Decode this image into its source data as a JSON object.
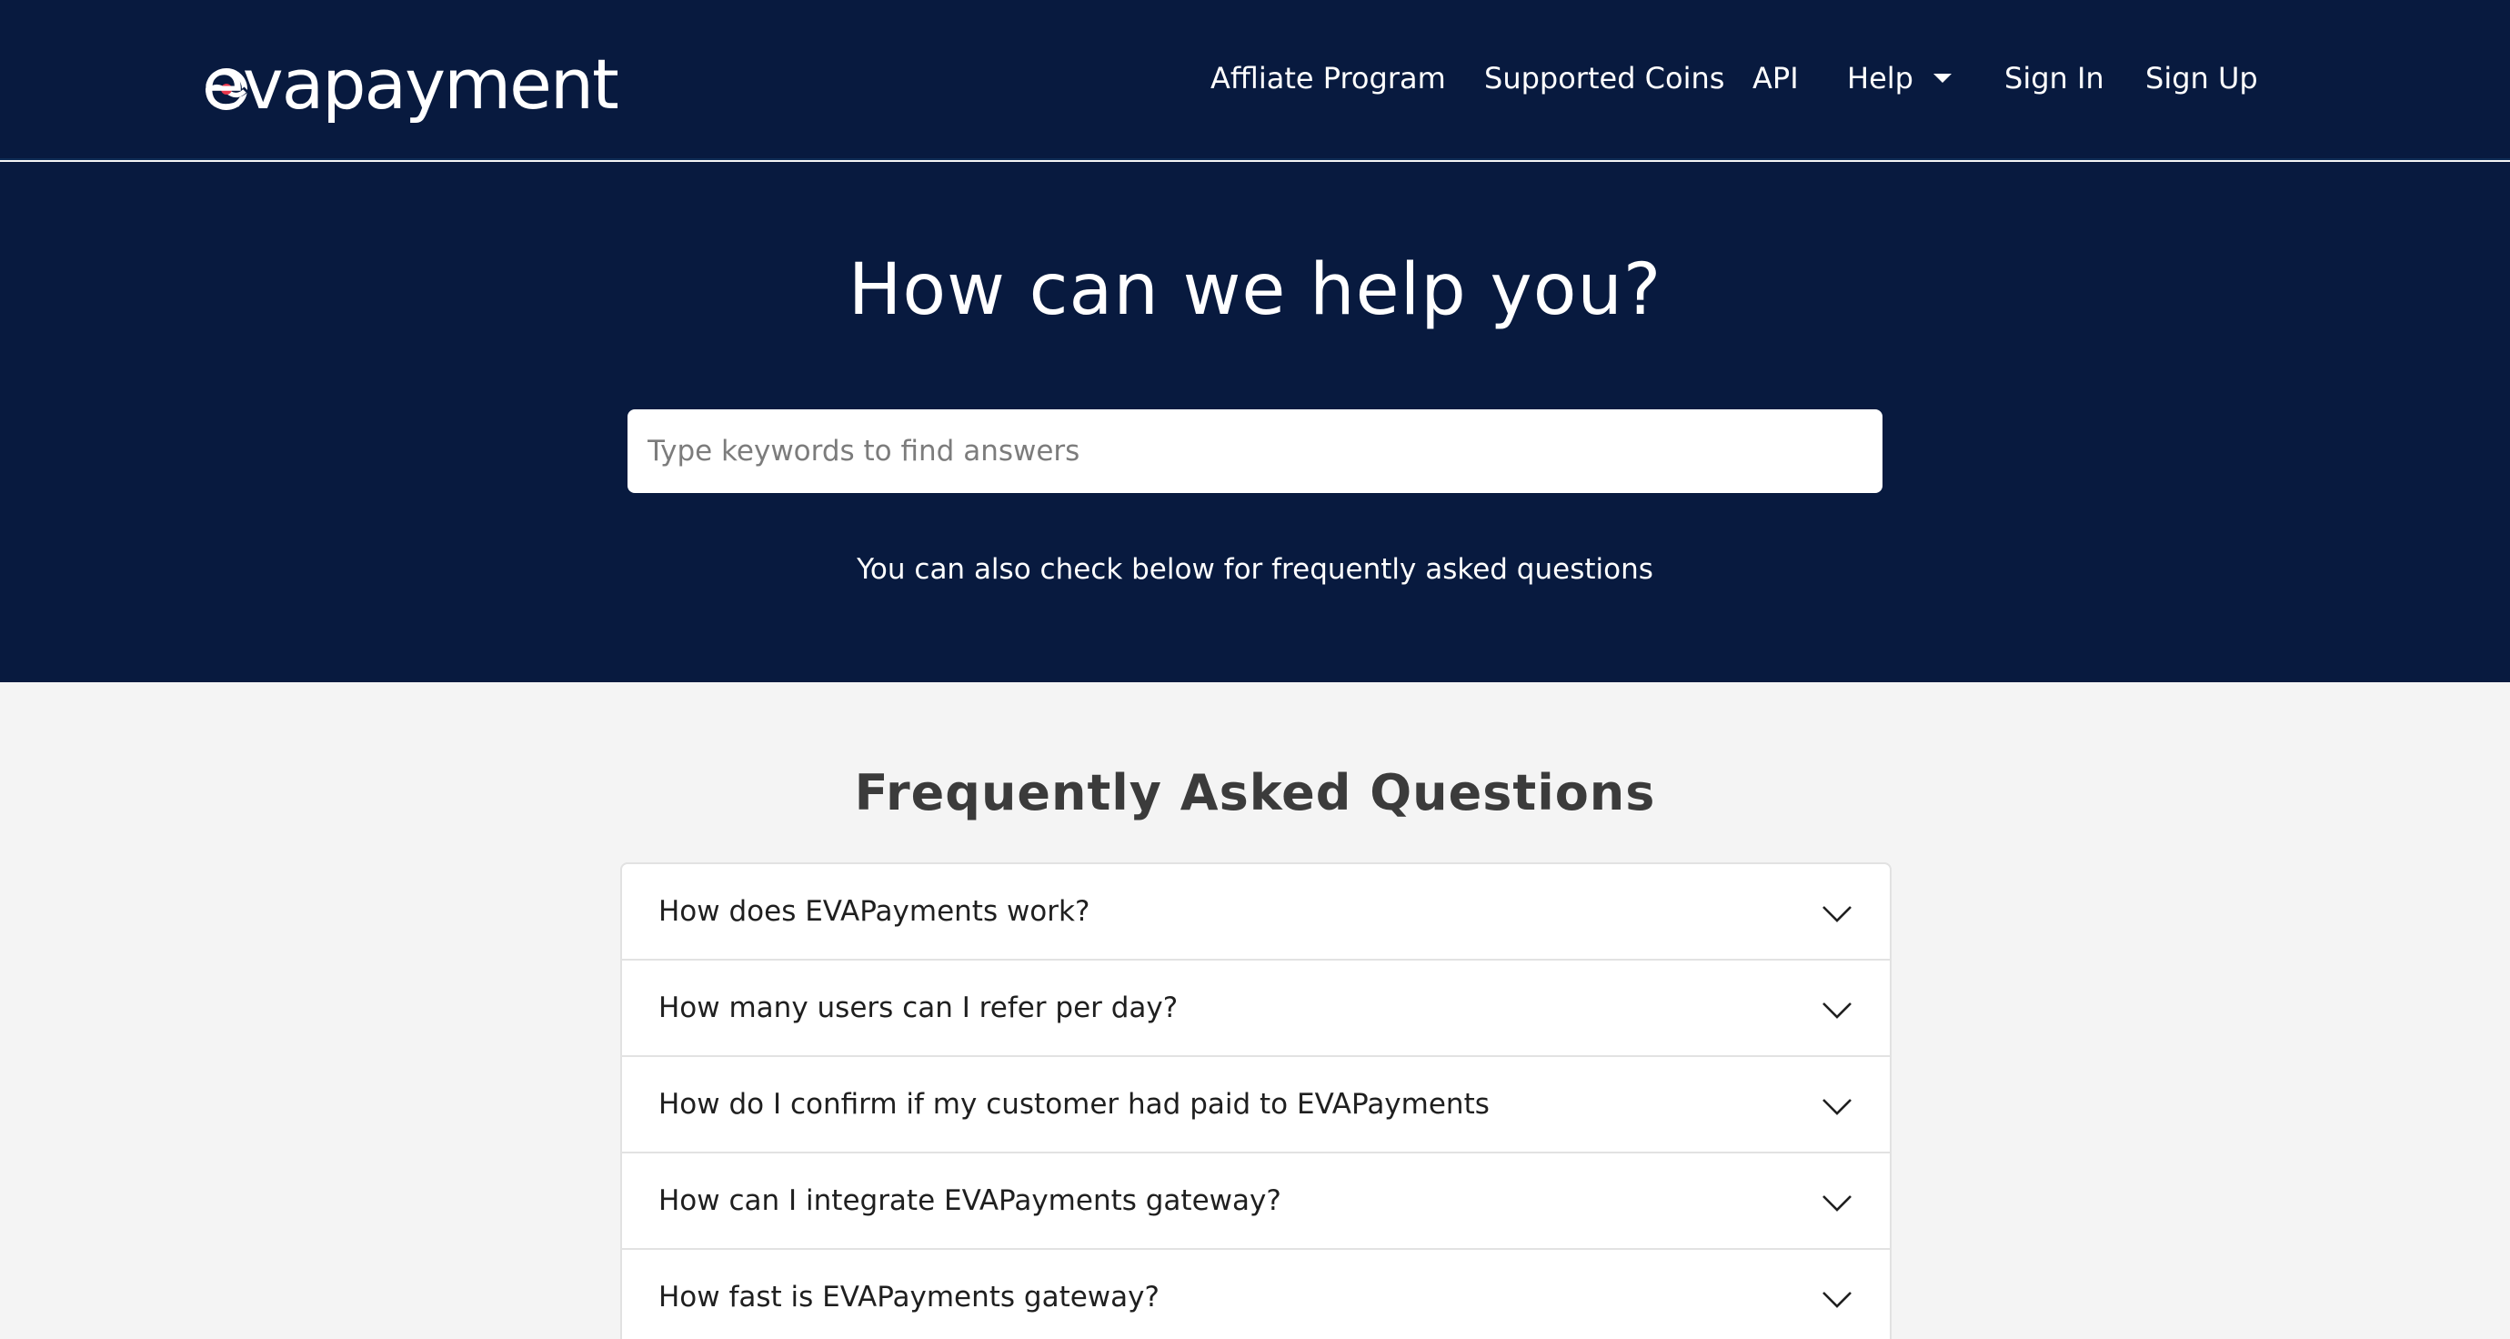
{
  "header": {
    "logo_text": "evapayment",
    "nav": [
      {
        "label": "Affliate Program"
      },
      {
        "label": "Supported Coins"
      },
      {
        "label": "API"
      },
      {
        "label": "Help"
      },
      {
        "label": "Sign In"
      },
      {
        "label": "Sign Up"
      }
    ]
  },
  "hero": {
    "title": "How can we help you?",
    "search_placeholder": "Type keywords to find answers",
    "subtitle": "You can also check below for frequently asked questions"
  },
  "faq": {
    "title": "Frequently Asked Questions",
    "items": [
      {
        "question": "How does EVAPayments work?"
      },
      {
        "question": "How many users can I refer per day?"
      },
      {
        "question": "How do I confirm if my customer had paid to EVAPayments"
      },
      {
        "question": "How can I integrate EVAPayments gateway?"
      },
      {
        "question": "How fast is EVAPayments gateway?"
      }
    ]
  },
  "icons": {
    "logo_mark": "evapayment-logo-icon",
    "help_dropdown": "caret-down-icon",
    "faq_expand": "chevron-down-icon"
  },
  "colors": {
    "navy": "#081a3f",
    "logo_dot": "#e8374c",
    "page_bg": "#f4f4f4"
  }
}
